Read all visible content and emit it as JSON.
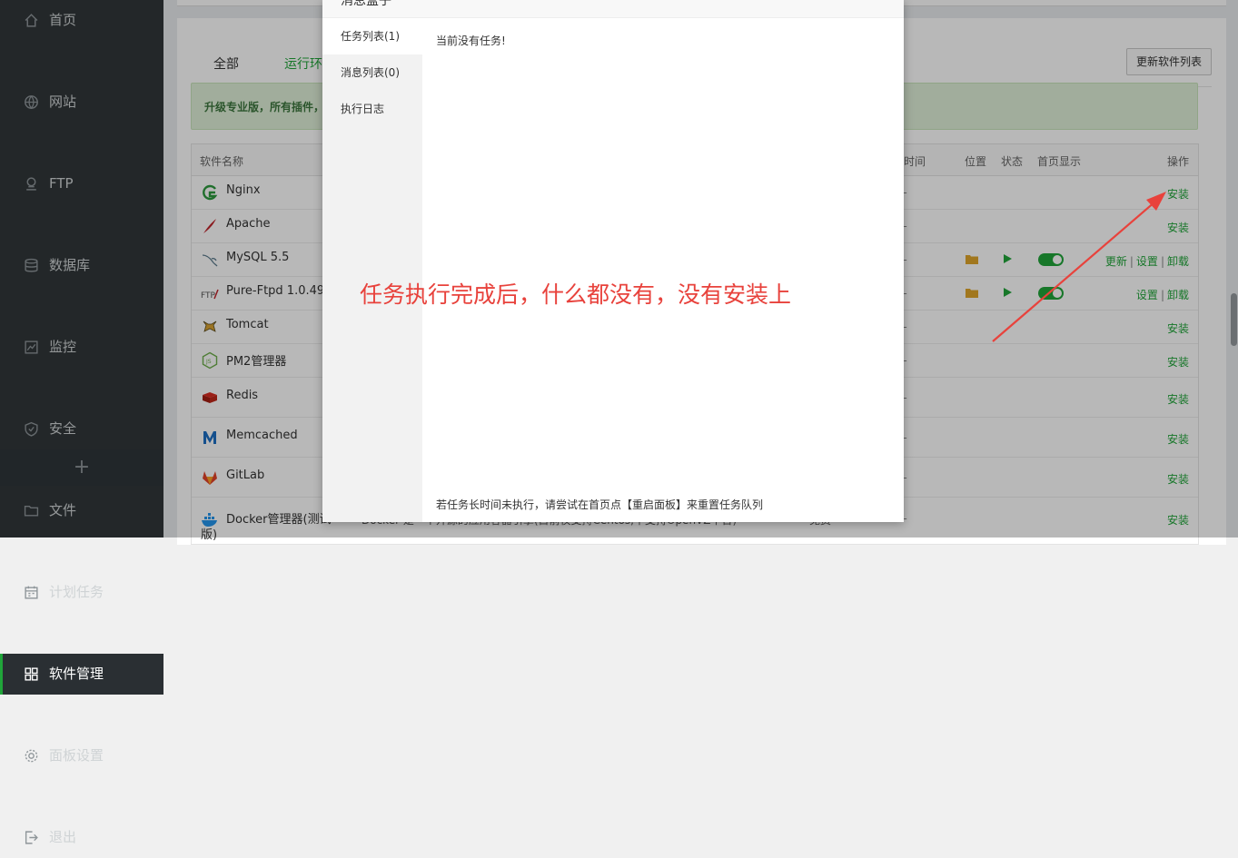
{
  "sidebar": {
    "items": [
      {
        "label": "首页",
        "icon": "home-icon"
      },
      {
        "label": "网站",
        "icon": "globe-icon"
      },
      {
        "label": "FTP",
        "icon": "ftp-icon"
      },
      {
        "label": "数据库",
        "icon": "database-icon"
      },
      {
        "label": "监控",
        "icon": "monitor-icon"
      },
      {
        "label": "安全",
        "icon": "shield-icon"
      },
      {
        "label": "文件",
        "icon": "folder-icon"
      },
      {
        "label": "计划任务",
        "icon": "calendar-icon"
      },
      {
        "label": "软件管理",
        "icon": "grid-icon",
        "active": true
      },
      {
        "label": "面板设置",
        "icon": "gear-icon"
      },
      {
        "label": "退出",
        "icon": "logout-icon"
      }
    ],
    "add_label": "+"
  },
  "main": {
    "tabs": [
      {
        "label": "全部"
      },
      {
        "label": "运行环"
      }
    ],
    "update_button": "更新软件列表",
    "alert_text": "升级专业版，所有插件，",
    "table": {
      "headers": {
        "name": "软件名称",
        "time": "时间",
        "location": "位置",
        "status": "状态",
        "home_display": "首页显示",
        "ops": "操作"
      },
      "rows": [
        {
          "name": "Nginx",
          "icon": "nginx-icon",
          "dash": "--",
          "ops": [
            "安装"
          ]
        },
        {
          "name": "Apache",
          "icon": "apache-icon",
          "dash": "--",
          "ops": [
            "安装"
          ]
        },
        {
          "name": "MySQL 5.5",
          "icon": "mysql-icon",
          "dash": "--",
          "installed": true,
          "ops": [
            "更新",
            "设置",
            "卸载"
          ]
        },
        {
          "name": "Pure-Ftpd 1.0.49",
          "icon": "ftp-logo-icon",
          "dash": "--",
          "installed": true,
          "ops": [
            "设置",
            "卸载"
          ]
        },
        {
          "name": "Tomcat",
          "icon": "tomcat-icon",
          "dash": "--",
          "ops": [
            "安装"
          ]
        },
        {
          "name": "PM2管理器",
          "icon": "nodejs-icon",
          "dash": "--",
          "ops": [
            "安装"
          ]
        },
        {
          "name": "Redis",
          "icon": "redis-icon",
          "dash": "--",
          "ops": [
            "安装"
          ]
        },
        {
          "name": "Memcached",
          "icon": "memcached-icon",
          "dash": "--",
          "ops": [
            "安装"
          ]
        },
        {
          "name": "GitLab",
          "icon": "gitlab-icon",
          "dash": "--",
          "ops": [
            "安装"
          ]
        },
        {
          "name": "Docker管理器(测试",
          "name2": "版)",
          "icon": "docker-icon",
          "desc": "Docker 是一个开源的应用容器引擎(目前仅支持Centos,不支持OpenVZ平台)",
          "price": "免费",
          "dash": "--",
          "ops": [
            "安装"
          ]
        }
      ]
    }
  },
  "modal": {
    "title": "消息盒子",
    "tabs": [
      {
        "label": "任务列表(1)",
        "active": true
      },
      {
        "label": "消息列表(0)"
      },
      {
        "label": "执行日志"
      }
    ],
    "no_task": "当前没有任务!",
    "footer_hint": "若任务长时间未执行，请尝试在首页点【重启面板】来重置任务队列"
  },
  "annotation": {
    "text": "任务执行完成后，什么都没有，没有安装上",
    "color": "#e8423c"
  },
  "colors": {
    "accent": "#20a53a",
    "sidebar_bg": "#31373a"
  }
}
